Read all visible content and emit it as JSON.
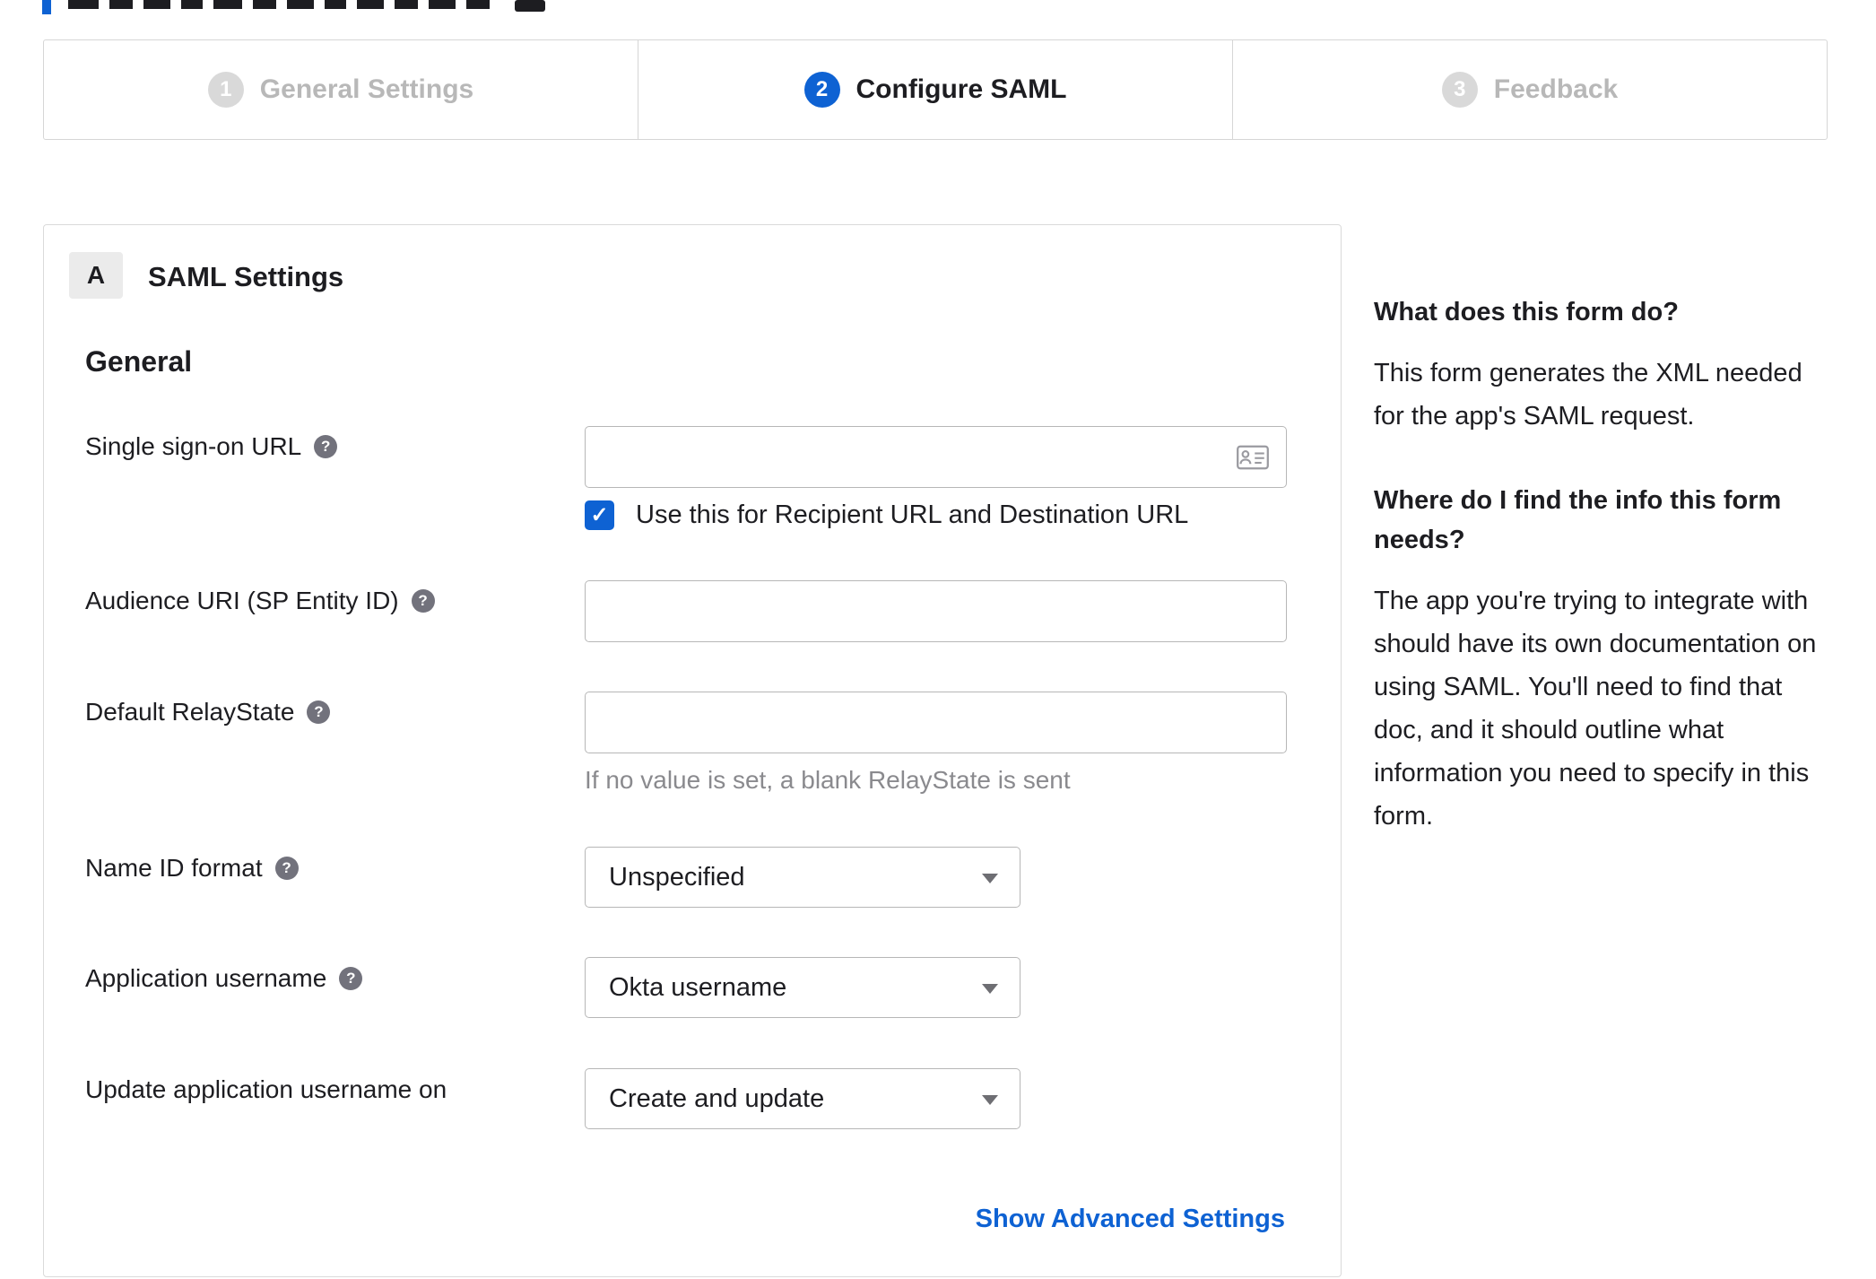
{
  "colors": {
    "accent_blue": "#0e62d3",
    "inactive_gray": "#d9d9d9",
    "text_dark": "#1d1d21",
    "hint_gray": "#8a8a8e"
  },
  "stepper": {
    "steps": [
      {
        "number": "1",
        "label": "General Settings",
        "active": false
      },
      {
        "number": "2",
        "label": "Configure SAML",
        "active": true
      },
      {
        "number": "3",
        "label": "Feedback",
        "active": false
      }
    ]
  },
  "panel": {
    "badge": "A",
    "title": "SAML Settings",
    "section": "General",
    "fields": {
      "sso": {
        "label": "Single sign-on URL",
        "value": "",
        "checkbox_label": "Use this for Recipient URL and Destination URL",
        "checked": true,
        "check_glyph": "✓"
      },
      "audience": {
        "label": "Audience URI (SP Entity ID)",
        "value": ""
      },
      "relay": {
        "label": "Default RelayState",
        "value": "",
        "hint": "If no value is set, a blank RelayState is sent"
      },
      "nameid": {
        "label": "Name ID format",
        "value": "Unspecified"
      },
      "appuser": {
        "label": "Application username",
        "value": "Okta username"
      },
      "updateuser": {
        "label": "Update application username on",
        "value": "Create and update"
      }
    },
    "advanced_link": "Show Advanced Settings",
    "help_glyph": "?"
  },
  "help_column": {
    "q1": "What does this form do?",
    "a1": "This form generates the XML needed for the app's SAML request.",
    "q2": "Where do I find the info this form needs?",
    "a2": "The app you're trying to integrate with should have its own documentation on using SAML. You'll need to find that doc, and it should outline what information you need to specify in this form."
  }
}
